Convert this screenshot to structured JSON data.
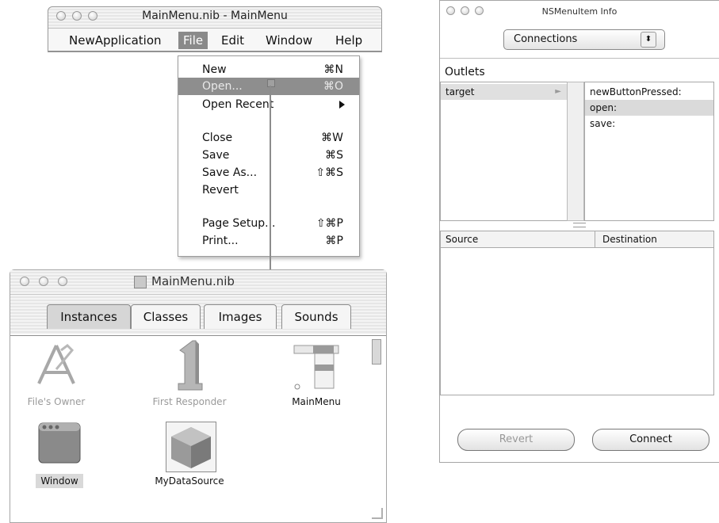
{
  "menu_window": {
    "title": "MainMenu.nib - MainMenu",
    "menubar": [
      "NewApplication",
      "File",
      "Edit",
      "Window",
      "Help"
    ]
  },
  "file_menu": {
    "items": [
      {
        "label": "New",
        "shortcut": "⌘N"
      },
      {
        "label": "Open...",
        "shortcut": "⌘O",
        "highlighted": true
      },
      {
        "label": "Open Recent",
        "submenu": true
      },
      {
        "label": "Close",
        "shortcut": "⌘W"
      },
      {
        "label": "Save",
        "shortcut": "⌘S"
      },
      {
        "label": "Save As...",
        "shortcut": "⇧⌘S"
      },
      {
        "label": "Revert"
      },
      {
        "label": "Page Setup...",
        "shortcut": "⇧⌘P"
      },
      {
        "label": "Print...",
        "shortcut": "⌘P"
      }
    ]
  },
  "nib_window": {
    "title": "MainMenu.nib",
    "tabs": [
      "Instances",
      "Classes",
      "Images",
      "Sounds"
    ],
    "instances": [
      {
        "label": "File's Owner",
        "icon": "file-owner-icon"
      },
      {
        "label": "First Responder",
        "icon": "first-responder-icon"
      },
      {
        "label": "MainMenu",
        "icon": "main-menu-icon"
      },
      {
        "label": "Window",
        "icon": "window-icon"
      },
      {
        "label": "MyDataSource",
        "icon": "cube-icon"
      }
    ]
  },
  "info_window": {
    "title": "NSMenuItem Info",
    "popup": "Connections",
    "outlets_label": "Outlets",
    "outlets": [
      "target"
    ],
    "actions": [
      "newButtonPressed:",
      "open:",
      "save:"
    ],
    "table_headers": [
      "Source",
      "Destination"
    ],
    "buttons": {
      "revert": "Revert",
      "connect": "Connect"
    }
  },
  "colors": {
    "selection": "#8e8e8e",
    "border": "#9a9a9a"
  }
}
